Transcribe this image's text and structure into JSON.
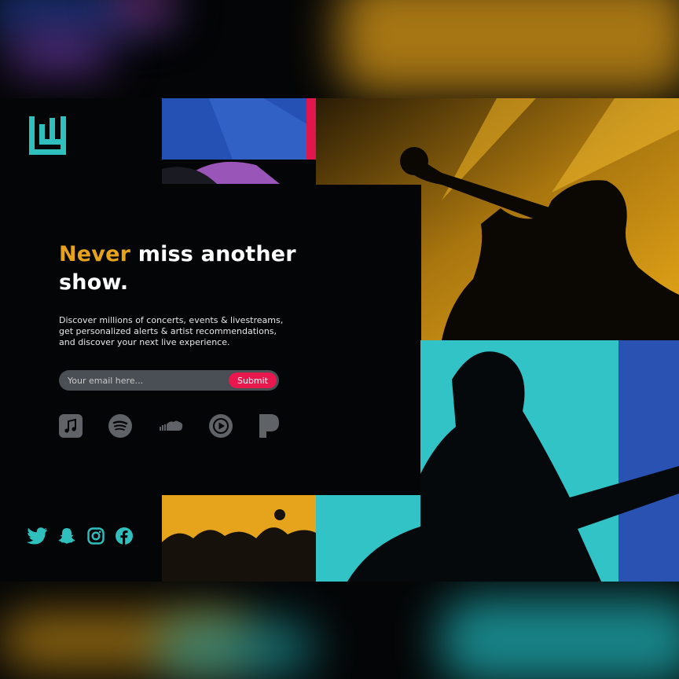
{
  "headline": {
    "accent_word": "Never",
    "rest_line1": " miss another",
    "line2": "show."
  },
  "description": "Discover millions of concerts, events & livestreams, get personalized alerts & artist recommendations, and discover your next live experience.",
  "signup": {
    "email_placeholder": "Your email here...",
    "submit_label": "Submit"
  },
  "streaming_services": [
    {
      "name": "apple-music-icon"
    },
    {
      "name": "spotify-icon"
    },
    {
      "name": "soundcloud-icon"
    },
    {
      "name": "youtube-music-icon"
    },
    {
      "name": "pandora-icon"
    }
  ],
  "social_links": [
    {
      "name": "twitter-icon"
    },
    {
      "name": "snapchat-icon"
    },
    {
      "name": "instagram-icon"
    },
    {
      "name": "facebook-icon"
    }
  ],
  "colors": {
    "accent_orange": "#e6a21a",
    "brand_teal": "#2fbfbd",
    "submit_pink": "#e8184f",
    "icon_gray": "#5f6368",
    "photo_blue": "#2b55b5",
    "photo_cyan": "#30c3c4"
  }
}
